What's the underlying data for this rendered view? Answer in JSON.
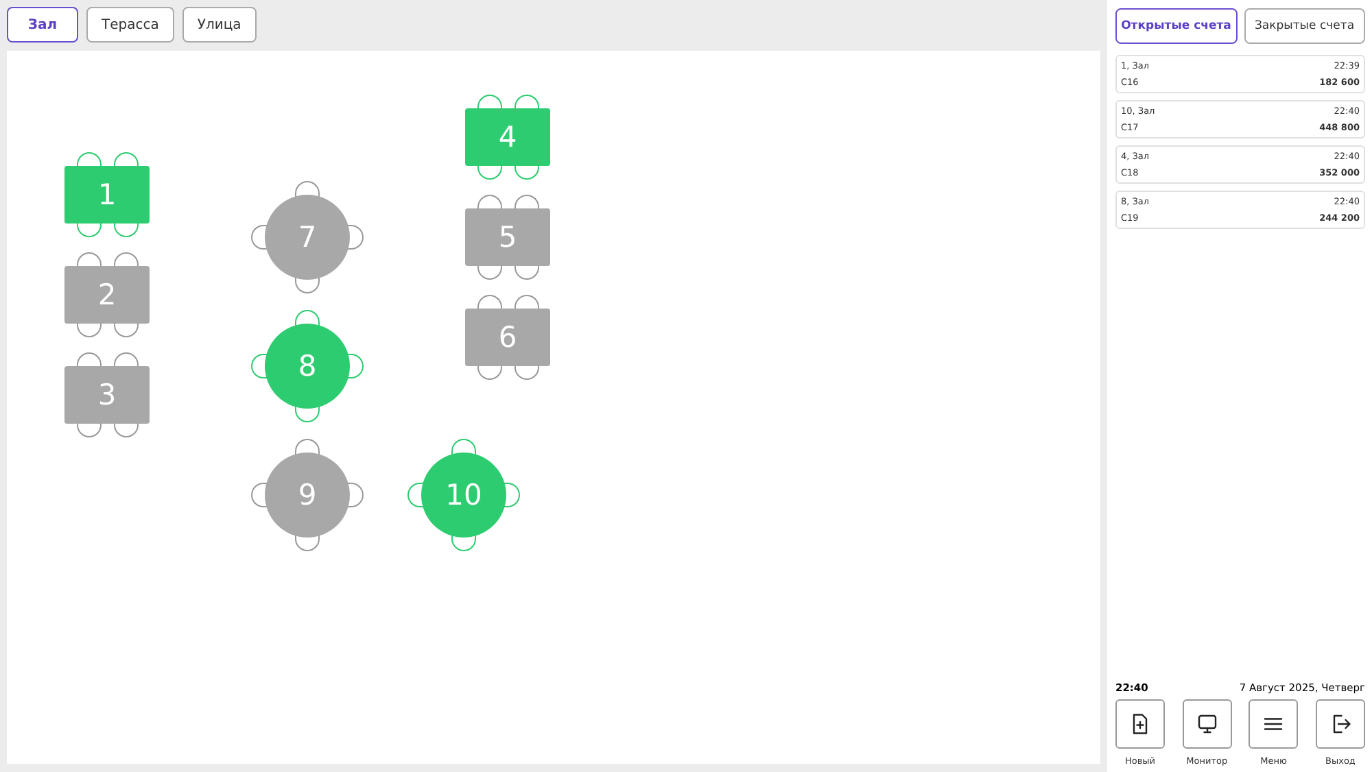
{
  "hall_tabs": [
    {
      "label": "Зал",
      "selected": true
    },
    {
      "label": "Терасса",
      "selected": false
    },
    {
      "label": "Улица",
      "selected": false
    }
  ],
  "tables": [
    {
      "number": "1",
      "kind": "rect",
      "occupied": true
    },
    {
      "number": "2",
      "kind": "rect",
      "occupied": false
    },
    {
      "number": "3",
      "kind": "rect",
      "occupied": false
    },
    {
      "number": "4",
      "kind": "rect",
      "occupied": true
    },
    {
      "number": "5",
      "kind": "rect",
      "occupied": false
    },
    {
      "number": "6",
      "kind": "rect",
      "occupied": false
    },
    {
      "number": "7",
      "kind": "round",
      "occupied": false
    },
    {
      "number": "8",
      "kind": "round",
      "occupied": true
    },
    {
      "number": "9",
      "kind": "round",
      "occupied": false
    },
    {
      "number": "10",
      "kind": "round",
      "occupied": true
    }
  ],
  "bill_tabs": [
    {
      "label": "Открытые счета",
      "selected": true
    },
    {
      "label": "Закрытые счета",
      "selected": false
    }
  ],
  "bills": [
    {
      "table": "1, Зал",
      "time": "22:39",
      "code": "C16",
      "amount": "182 600"
    },
    {
      "table": "10, Зал",
      "time": "22:40",
      "code": "C17",
      "amount": "448 800"
    },
    {
      "table": "4, Зал",
      "time": "22:40",
      "code": "C18",
      "amount": "352 000"
    },
    {
      "table": "8, Зал",
      "time": "22:40",
      "code": "C19",
      "amount": "244 200"
    }
  ],
  "clock": {
    "time": "22:40",
    "date": "7 Август 2025, Четверг"
  },
  "actions": [
    {
      "kind": "new",
      "label": "Новый"
    },
    {
      "kind": "monitor",
      "label": "Монитор"
    },
    {
      "kind": "menu",
      "label": "Меню"
    },
    {
      "kind": "exit",
      "label": "Выход"
    }
  ]
}
